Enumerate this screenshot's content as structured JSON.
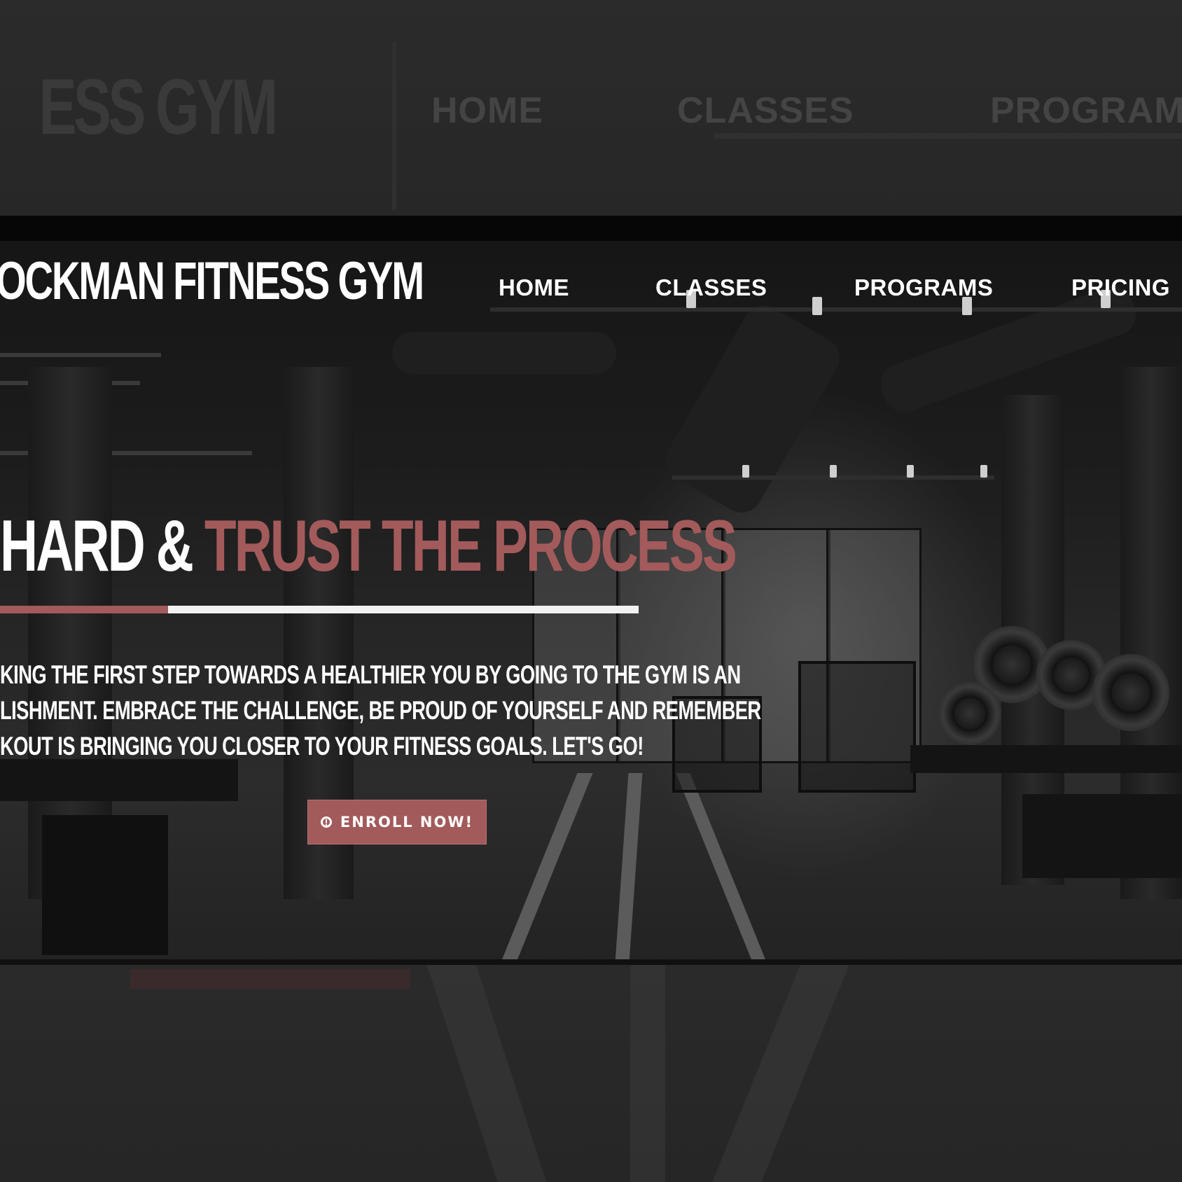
{
  "site": {
    "logo": "OCKMAN FITNESS GYM",
    "backdrop_logo": "ESS GYM"
  },
  "nav": {
    "items": [
      {
        "label": "HOME"
      },
      {
        "label": "CLASSES"
      },
      {
        "label": "PROGRAMS"
      },
      {
        "label": "PRICING"
      }
    ],
    "backdrop_items": [
      {
        "label": "HOME"
      },
      {
        "label": "CLASSES"
      },
      {
        "label": "PROGRAMS"
      }
    ]
  },
  "hero": {
    "headline_white": "HARD & ",
    "headline_accent": "TRUST THE PROCESS",
    "paragraph_lines": [
      "KING THE FIRST STEP TOWARDS A HEALTHIER YOU BY GOING TO THE GYM IS AN",
      "LISHMENT. EMBRACE THE CHALLENGE, BE PROUD OF YOURSELF AND REMEMBER",
      "KOUT IS BRINGING YOU CLOSER TO YOUR FITNESS GOALS. LET'S GO!"
    ],
    "cta_label": "ENROLL NOW!"
  },
  "colors": {
    "accent": "#a35a5b",
    "background": "#252525",
    "text": "#ffffff"
  },
  "icons": {
    "cta_icon": "exclamation-circle-icon"
  }
}
